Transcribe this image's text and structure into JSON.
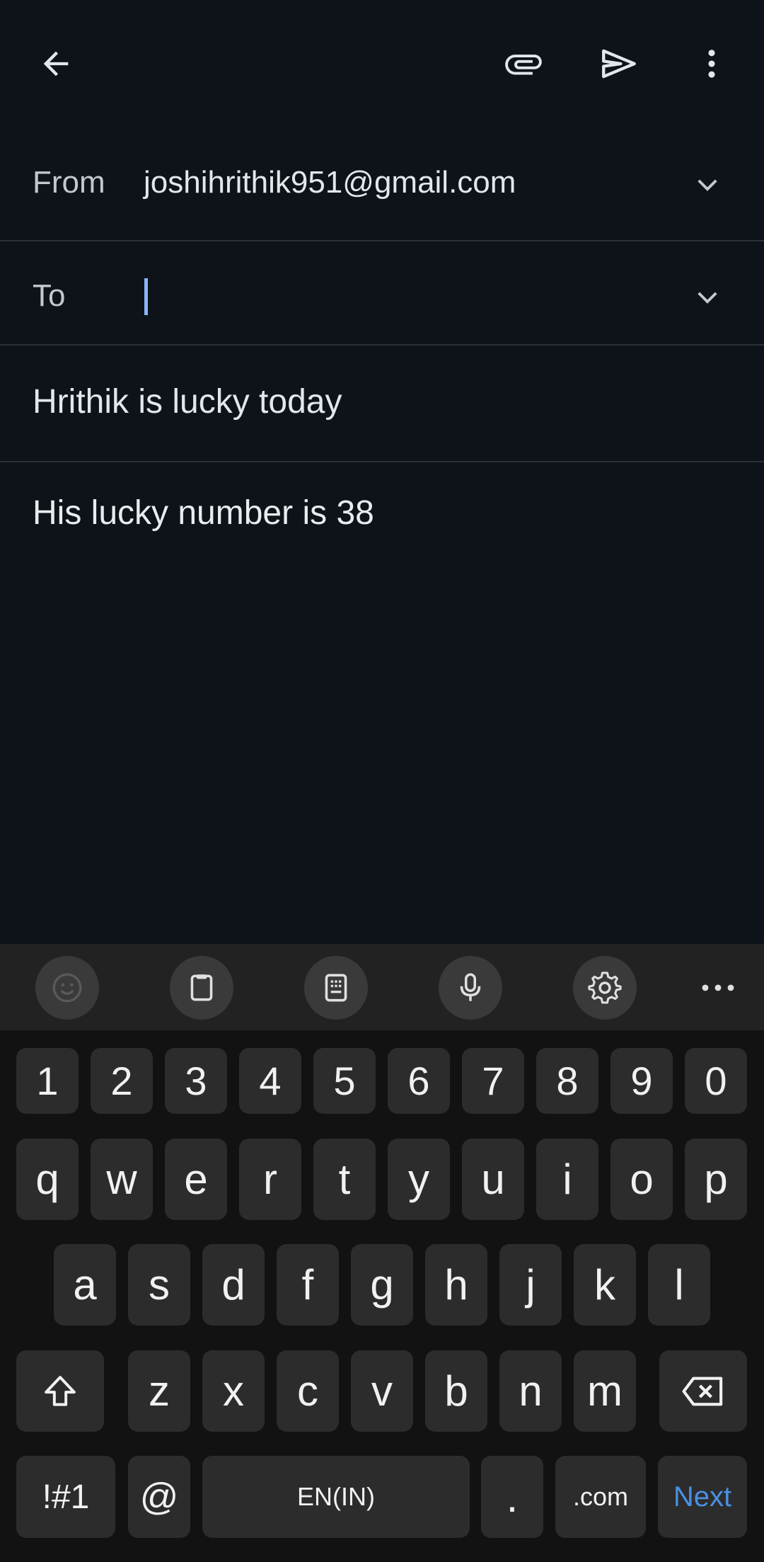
{
  "topbar": {
    "back_icon": "arrow-back-icon",
    "attach_icon": "paperclip-icon",
    "send_icon": "send-icon",
    "more_icon": "more-vert-icon"
  },
  "compose": {
    "from_label": "From",
    "from_value": "joshihrithik951@gmail.com",
    "to_label": "To",
    "to_value": "",
    "subject": "Hrithik is lucky today",
    "body": "His lucky number is 38"
  },
  "keyboard": {
    "toolbar": [
      "emoji-icon",
      "clipboard-icon",
      "keypad-icon",
      "microphone-icon",
      "settings-icon",
      "more-horiz-icon"
    ],
    "row_numbers": [
      "1",
      "2",
      "3",
      "4",
      "5",
      "6",
      "7",
      "8",
      "9",
      "0"
    ],
    "row1": [
      "q",
      "w",
      "e",
      "r",
      "t",
      "y",
      "u",
      "i",
      "o",
      "p"
    ],
    "row2": [
      "a",
      "s",
      "d",
      "f",
      "g",
      "h",
      "j",
      "k",
      "l"
    ],
    "row3": [
      "z",
      "x",
      "c",
      "v",
      "b",
      "n",
      "m"
    ],
    "symbols_label": "!#1",
    "at_label": "@",
    "space_label": "EN(IN)",
    "period_label": ".",
    "dotcom_label": ".com",
    "next_label": "Next",
    "accent_color": "#4a90e2"
  }
}
